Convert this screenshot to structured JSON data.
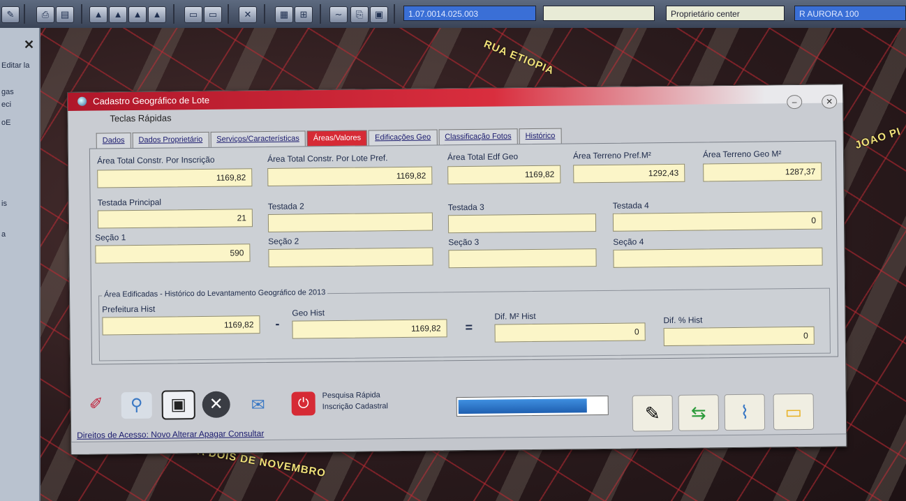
{
  "toolbar": {
    "field1": "1.07.0014.025.003",
    "field2": "Proprietário center",
    "field3": "R AURORA 100"
  },
  "side": {
    "labels": [
      "Editar la",
      "gas",
      "eci",
      "oE",
      "is",
      "a"
    ]
  },
  "map": {
    "street1": "RUA ETIOPIA",
    "street2": "RUA DOIS DE NOVEMBRO",
    "street3": "JOAO PI"
  },
  "dialog": {
    "title": "Cadastro Geográfico de Lote",
    "menu": "Teclas Rápidas",
    "tabs": [
      "Dados",
      "Dados Proprietário",
      "Serviços/Características",
      "Áreas/Valores",
      "Edificações Geo",
      "Classificação Fotos",
      "Histórico"
    ],
    "active_tab": "Áreas/Valores",
    "row1": [
      {
        "label": "Área Total Constr. Por Inscrição",
        "value": "1169,82"
      },
      {
        "label": "Área Total Constr. Por Lote Pref.",
        "value": "1169,82"
      },
      {
        "label": "Área Total Edf Geo",
        "value": "1169,82"
      },
      {
        "label": "Área Terreno Pref.M²",
        "value": "1292,43"
      },
      {
        "label": "Área Terreno Geo M²",
        "value": "1287,37"
      }
    ],
    "row2": [
      {
        "label": "Testada Principal",
        "value": "21"
      },
      {
        "label": "Testada 2",
        "value": ""
      },
      {
        "label": "Testada 3",
        "value": ""
      },
      {
        "label": "Testada 4",
        "value": "0"
      }
    ],
    "row3": [
      {
        "label": "Seção 1",
        "value": "590"
      },
      {
        "label": "Seção 2",
        "value": ""
      },
      {
        "label": "Seção 3",
        "value": ""
      },
      {
        "label": "Seção 4",
        "value": ""
      }
    ],
    "group": {
      "title": "Área Edificadas - Histórico do Levantamento Geográfico de 2013",
      "fields": [
        {
          "label": "Prefeitura Hist",
          "value": "1169,82"
        },
        {
          "label": "Geo Hist",
          "value": "1169,82"
        },
        {
          "label": "Dif. M² Hist",
          "value": "0"
        },
        {
          "label": "Dif. % Hist",
          "value": "0"
        }
      ],
      "op_minus": "-",
      "op_equals": "="
    },
    "pesquisa": {
      "line1": "Pesquisa Rápida",
      "line2": "Inscrição Cadastral"
    },
    "progress": 0.85,
    "access": "Direitos de Acesso: Novo  Alterar  Apagar  Consultar"
  }
}
